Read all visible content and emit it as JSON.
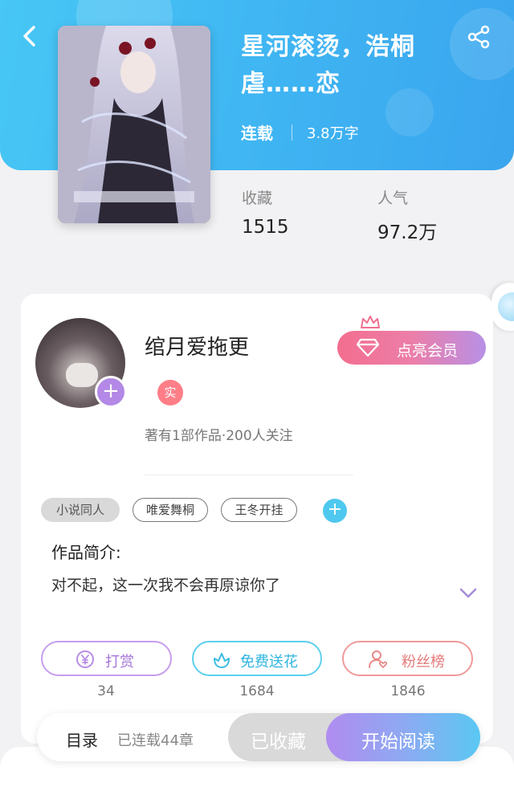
{
  "book": {
    "title": "星河滚烫，浩桐虐……恋",
    "status": "连载",
    "word_count": "3.8万字",
    "stats": [
      {
        "label": "收藏",
        "value": "1515"
      },
      {
        "label": "人气",
        "value": "97.2万"
      }
    ]
  },
  "author": {
    "name": "绾月爱拖更",
    "badge": "实",
    "meta": "著有1部作品·200人关注",
    "vip_button": "点亮会员"
  },
  "tags": [
    "小说同人",
    "唯爱舞桐",
    "王冬开挂"
  ],
  "synopsis": {
    "title": "作品简介:",
    "text": "对不起，这一次我不会再原谅你了"
  },
  "actions": [
    {
      "label": "打赏",
      "count": "34",
      "icon": "yuan-coin-icon"
    },
    {
      "label": "免费送花",
      "count": "1684",
      "icon": "flower-icon"
    },
    {
      "label": "粉丝榜",
      "count": "1846",
      "icon": "fan-rank-icon"
    }
  ],
  "bottom_bar": {
    "toc": "目录",
    "chapters": "已连载44章",
    "collected": "已收藏",
    "read": "开始阅读"
  },
  "colors": {
    "header_blue": "#3fb4f2",
    "vip_pink": "#f36e8f",
    "avatar_plus": "#b388e6",
    "real_badge": "#ff7e88",
    "tag_add": "#4fc8ef"
  }
}
